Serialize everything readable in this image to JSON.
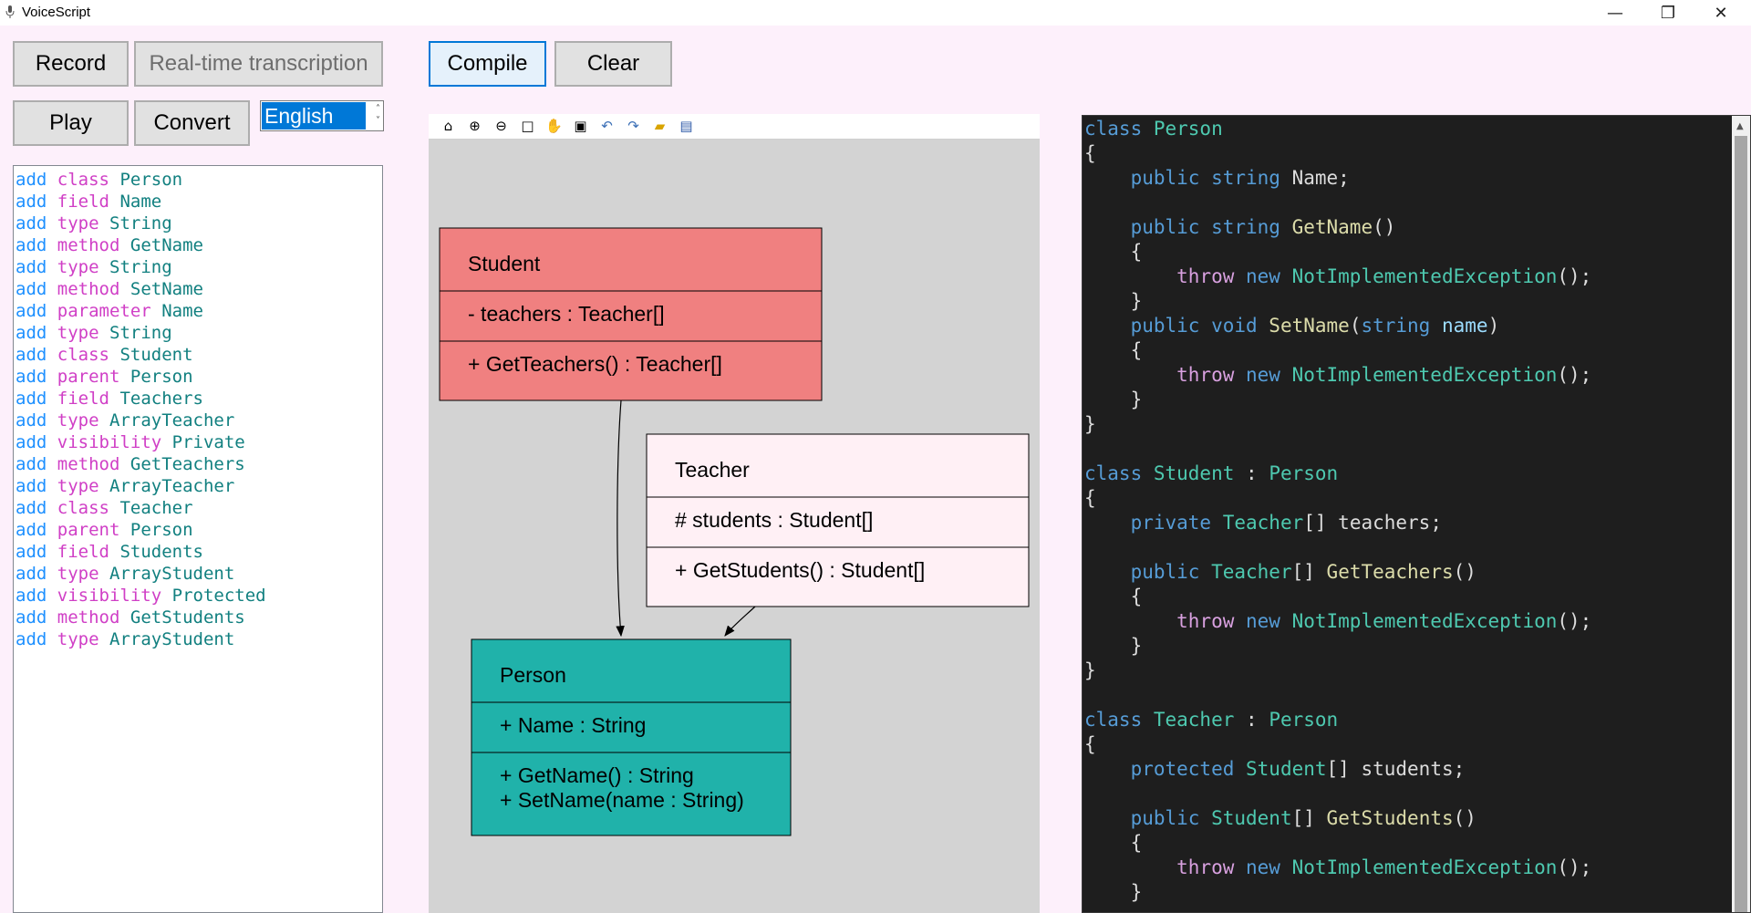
{
  "window": {
    "title": "VoiceScript",
    "minimize": "—",
    "restore": "❐",
    "close": "✕"
  },
  "buttons": {
    "record": "Record",
    "realtime": "Real-time transcription",
    "play": "Play",
    "convert": "Convert",
    "compile": "Compile",
    "clear": "Clear"
  },
  "language": {
    "selected": "English"
  },
  "commands": [
    [
      "add",
      "class",
      "Person"
    ],
    [
      "add",
      "field",
      "Name"
    ],
    [
      "add",
      "type",
      "String"
    ],
    [
      "add",
      "method",
      "GetName"
    ],
    [
      "add",
      "type",
      "String"
    ],
    [
      "add",
      "method",
      "SetName"
    ],
    [
      "add",
      "parameter",
      "Name"
    ],
    [
      "add",
      "type",
      "String"
    ],
    [
      "add",
      "class",
      "Student"
    ],
    [
      "add",
      "parent",
      "Person"
    ],
    [
      "add",
      "field",
      "Teachers"
    ],
    [
      "add",
      "type",
      "ArrayTeacher"
    ],
    [
      "add",
      "visibility",
      "Private"
    ],
    [
      "add",
      "method",
      "GetTeachers"
    ],
    [
      "add",
      "type",
      "ArrayTeacher"
    ],
    [
      "add",
      "class",
      "Teacher"
    ],
    [
      "add",
      "parent",
      "Person"
    ],
    [
      "add",
      "field",
      "Students"
    ],
    [
      "add",
      "type",
      "ArrayStudent"
    ],
    [
      "add",
      "visibility",
      "Protected"
    ],
    [
      "add",
      "method",
      "GetStudents"
    ],
    [
      "add",
      "type",
      "ArrayStudent"
    ]
  ],
  "toolbar_icons": [
    "home-icon",
    "zoom-in-icon",
    "zoom-out-icon",
    "fit-icon",
    "pan-icon",
    "save-icon",
    "undo-icon",
    "redo-icon",
    "open-icon",
    "print-icon"
  ],
  "diagram": {
    "classes": [
      {
        "id": "student",
        "name": "Student",
        "attributes": [
          "- teachers : Teacher[]"
        ],
        "methods": [
          "+ GetTeachers() : Teacher[]"
        ],
        "fill": "#f08080"
      },
      {
        "id": "teacher",
        "name": "Teacher",
        "attributes": [
          "# students : Student[]"
        ],
        "methods": [
          "+ GetStudents() : Student[]"
        ],
        "fill": "#fff0f5"
      },
      {
        "id": "person",
        "name": "Person",
        "attributes": [
          "+ Name : String"
        ],
        "methods": [
          "+ GetName() : String",
          "+ SetName(name : String)"
        ],
        "fill": "#20b2aa"
      }
    ]
  },
  "code": [
    [
      [
        "kw",
        "class "
      ],
      [
        "type",
        "Person"
      ]
    ],
    [
      [
        "plain",
        "{"
      ]
    ],
    [
      [
        "plain",
        "    "
      ],
      [
        "kw",
        "public string "
      ],
      [
        "plain",
        "Name;"
      ]
    ],
    [],
    [
      [
        "plain",
        "    "
      ],
      [
        "kw",
        "public string "
      ],
      [
        "method",
        "GetName"
      ],
      [
        "plain",
        "()"
      ]
    ],
    [
      [
        "plain",
        "    {"
      ]
    ],
    [
      [
        "plain",
        "        "
      ],
      [
        "ctl",
        "throw "
      ],
      [
        "kw",
        "new "
      ],
      [
        "type",
        "NotImplementedException"
      ],
      [
        "plain",
        "();"
      ]
    ],
    [
      [
        "plain",
        "    }"
      ]
    ],
    [
      [
        "plain",
        "    "
      ],
      [
        "kw",
        "public void "
      ],
      [
        "method",
        "SetName"
      ],
      [
        "plain",
        "("
      ],
      [
        "kw",
        "string "
      ],
      [
        "param",
        "name"
      ],
      [
        "plain",
        ")"
      ]
    ],
    [
      [
        "plain",
        "    {"
      ]
    ],
    [
      [
        "plain",
        "        "
      ],
      [
        "ctl",
        "throw "
      ],
      [
        "kw",
        "new "
      ],
      [
        "type",
        "NotImplementedException"
      ],
      [
        "plain",
        "();"
      ]
    ],
    [
      [
        "plain",
        "    }"
      ]
    ],
    [
      [
        "plain",
        "}"
      ]
    ],
    [],
    [
      [
        "kw",
        "class "
      ],
      [
        "type",
        "Student"
      ],
      [
        "plain",
        " : "
      ],
      [
        "type",
        "Person"
      ]
    ],
    [
      [
        "plain",
        "{"
      ]
    ],
    [
      [
        "plain",
        "    "
      ],
      [
        "kw",
        "private "
      ],
      [
        "type",
        "Teacher"
      ],
      [
        "plain",
        "[] teachers;"
      ]
    ],
    [],
    [
      [
        "plain",
        "    "
      ],
      [
        "kw",
        "public "
      ],
      [
        "type",
        "Teacher"
      ],
      [
        "plain",
        "[] "
      ],
      [
        "method",
        "GetTeachers"
      ],
      [
        "plain",
        "()"
      ]
    ],
    [
      [
        "plain",
        "    {"
      ]
    ],
    [
      [
        "plain",
        "        "
      ],
      [
        "ctl",
        "throw "
      ],
      [
        "kw",
        "new "
      ],
      [
        "type",
        "NotImplementedException"
      ],
      [
        "plain",
        "();"
      ]
    ],
    [
      [
        "plain",
        "    }"
      ]
    ],
    [
      [
        "plain",
        "}"
      ]
    ],
    [],
    [
      [
        "kw",
        "class "
      ],
      [
        "type",
        "Teacher"
      ],
      [
        "plain",
        " : "
      ],
      [
        "type",
        "Person"
      ]
    ],
    [
      [
        "plain",
        "{"
      ]
    ],
    [
      [
        "plain",
        "    "
      ],
      [
        "kw",
        "protected "
      ],
      [
        "type",
        "Student"
      ],
      [
        "plain",
        "[] students;"
      ]
    ],
    [],
    [
      [
        "plain",
        "    "
      ],
      [
        "kw",
        "public "
      ],
      [
        "type",
        "Student"
      ],
      [
        "plain",
        "[] "
      ],
      [
        "method",
        "GetStudents"
      ],
      [
        "plain",
        "()"
      ]
    ],
    [
      [
        "plain",
        "    {"
      ]
    ],
    [
      [
        "plain",
        "        "
      ],
      [
        "ctl",
        "throw "
      ],
      [
        "kw",
        "new "
      ],
      [
        "type",
        "NotImplementedException"
      ],
      [
        "plain",
        "();"
      ]
    ],
    [
      [
        "plain",
        "    }"
      ]
    ]
  ]
}
